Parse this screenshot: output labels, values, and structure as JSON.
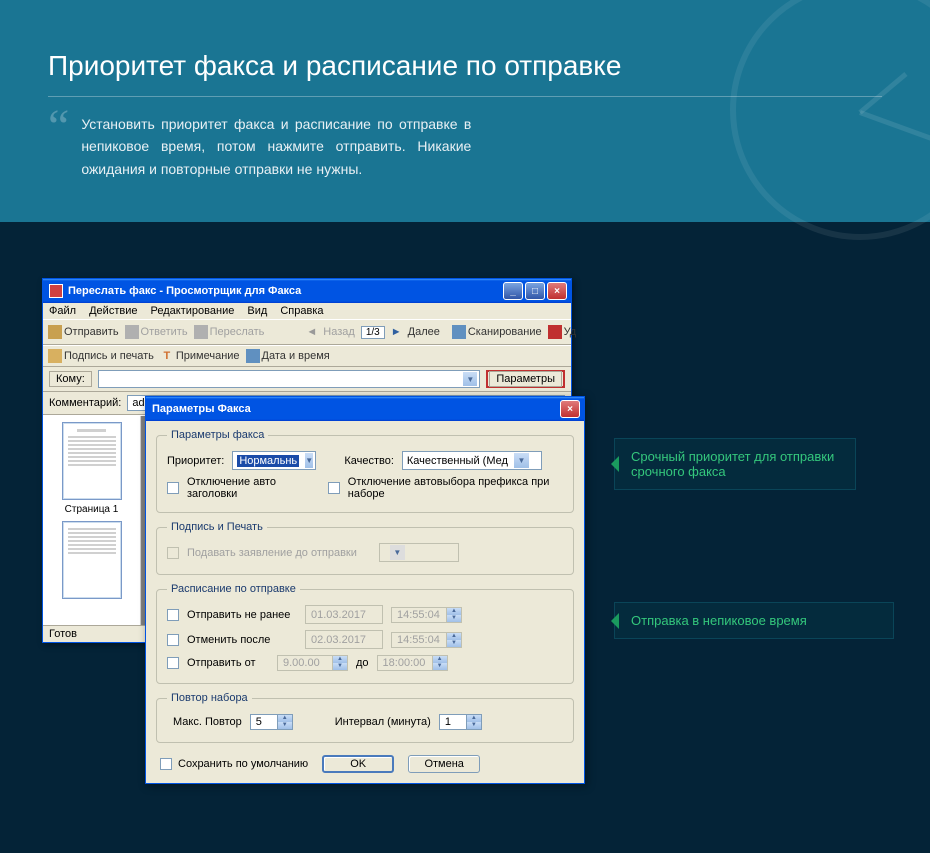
{
  "header": {
    "title": "Приоритет факса и расписание по отправке",
    "description": "Установить приоритет факса и расписание по отправке в непиковое время, потом нажмите отправить. Никакие ожидания и повторные отправки не нужны."
  },
  "viewer": {
    "title": "Переслать факс - Просмотрщик для Факса",
    "menu": [
      "Файл",
      "Действие",
      "Редактирование",
      "Вид",
      "Справка"
    ],
    "tb": {
      "send": "Отправить",
      "reply": "Ответить",
      "forward": "Переслать",
      "back": "Назад",
      "pages": "1/3",
      "next": "Далее",
      "scan": "Сканирование",
      "del": "Уд"
    },
    "tb2": {
      "sign": "Подпись и печать",
      "note": "Примечание",
      "date": "Дата и время"
    },
    "addr": {
      "to": "Кому:",
      "params": "Параметры"
    },
    "comment": {
      "label": "Комментарий:",
      "value": "admin:Отвечено"
    },
    "page_label": "Страница 1",
    "status": "Готов"
  },
  "dialog": {
    "title": "Параметры Факса",
    "g1": {
      "legend": "Параметры факса",
      "priority": "Приоритет:",
      "priority_val": "Нормальнь",
      "quality": "Качество:",
      "quality_val": "Качественный (Мед",
      "chk1": "Отключение авто заголовки",
      "chk2": "Отключение автовыбора префикса при наборе"
    },
    "g2": {
      "legend": "Подпись и Печать",
      "chk": "Подавать заявление до отправки"
    },
    "g3": {
      "legend": "Расписание по отправке",
      "r1": "Отправить не ранее",
      "r1_date": "01.03.2017",
      "r1_time": "14:55:04",
      "r2": "Отменить после",
      "r2_date": "02.03.2017",
      "r2_time": "14:55:04",
      "r3": "Отправить от",
      "r3_from": "9.00.00",
      "to": "до",
      "r3_to": "18:00:00"
    },
    "g4": {
      "legend": "Повтор набора",
      "max": "Макс. Повтор",
      "max_val": "5",
      "interval": "Интервал (минута)",
      "interval_val": "1"
    },
    "save": "Сохранить по умолчанию",
    "ok": "OK",
    "cancel": "Отмена"
  },
  "callout1": "Срочный приоритет для отправки срочного факса",
  "callout2": "Отправка в непиковое время"
}
